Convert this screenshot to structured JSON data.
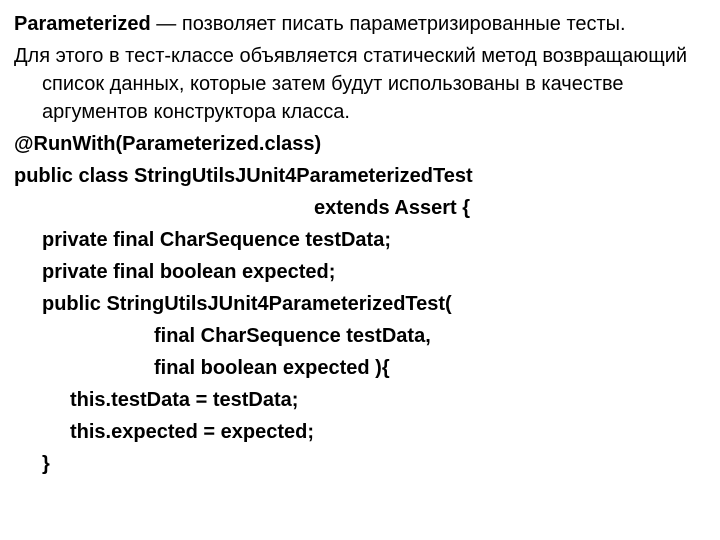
{
  "intro": {
    "term": "Parameterized",
    "desc": " — позволяет писать параметризированные тесты."
  },
  "para2": "Для этого в тест-классе объявляется статический метод возвращающий список данных, которые затем будут использованы в качестве аргументов конструктора класса.",
  "code": {
    "l1": "@RunWith(Parameterized.class)",
    "l2": "public class StringUtilsJUnit4ParameterizedTest",
    "l3": "extends Assert {",
    "l4": "private final CharSequence testData;",
    "l5": "private final boolean expected;",
    "l6": "public StringUtilsJUnit4ParameterizedTest(",
    "l7": "final CharSequence testData,",
    "l8": "final boolean expected ){",
    "l9": "this.testData = testData;",
    "l10": "this.expected = expected;",
    "l11": "}"
  }
}
